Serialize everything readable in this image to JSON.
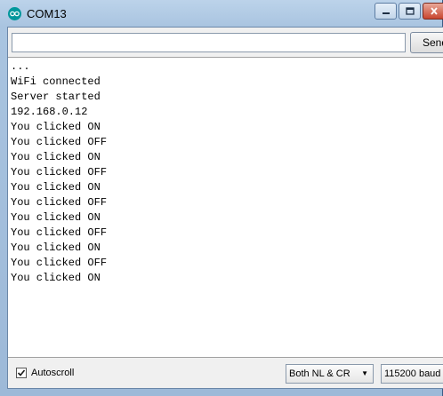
{
  "window": {
    "title": "COM13"
  },
  "send": {
    "input_value": "",
    "button_label": "Send"
  },
  "output": {
    "lines": [
      "...",
      "WiFi connected",
      "Server started",
      "192.168.0.12",
      "You clicked ON",
      "You clicked OFF",
      "You clicked ON",
      "You clicked OFF",
      "You clicked ON",
      "You clicked OFF",
      "You clicked ON",
      "You clicked OFF",
      "You clicked ON",
      "You clicked OFF",
      "You clicked ON"
    ]
  },
  "footer": {
    "autoscroll_label": "Autoscroll",
    "autoscroll_checked": true,
    "line_ending": "Both NL & CR",
    "baud_rate": "115200 baud"
  },
  "icons": {
    "app": "arduino-logo-icon",
    "minimize": "minimize-icon",
    "maximize": "maximize-icon",
    "close": "close-icon",
    "dropdown": "chevron-down-icon"
  },
  "colors": {
    "arduino_teal": "#00979c",
    "title_bar": "#bcd3ea",
    "close_button": "#c8452e"
  }
}
